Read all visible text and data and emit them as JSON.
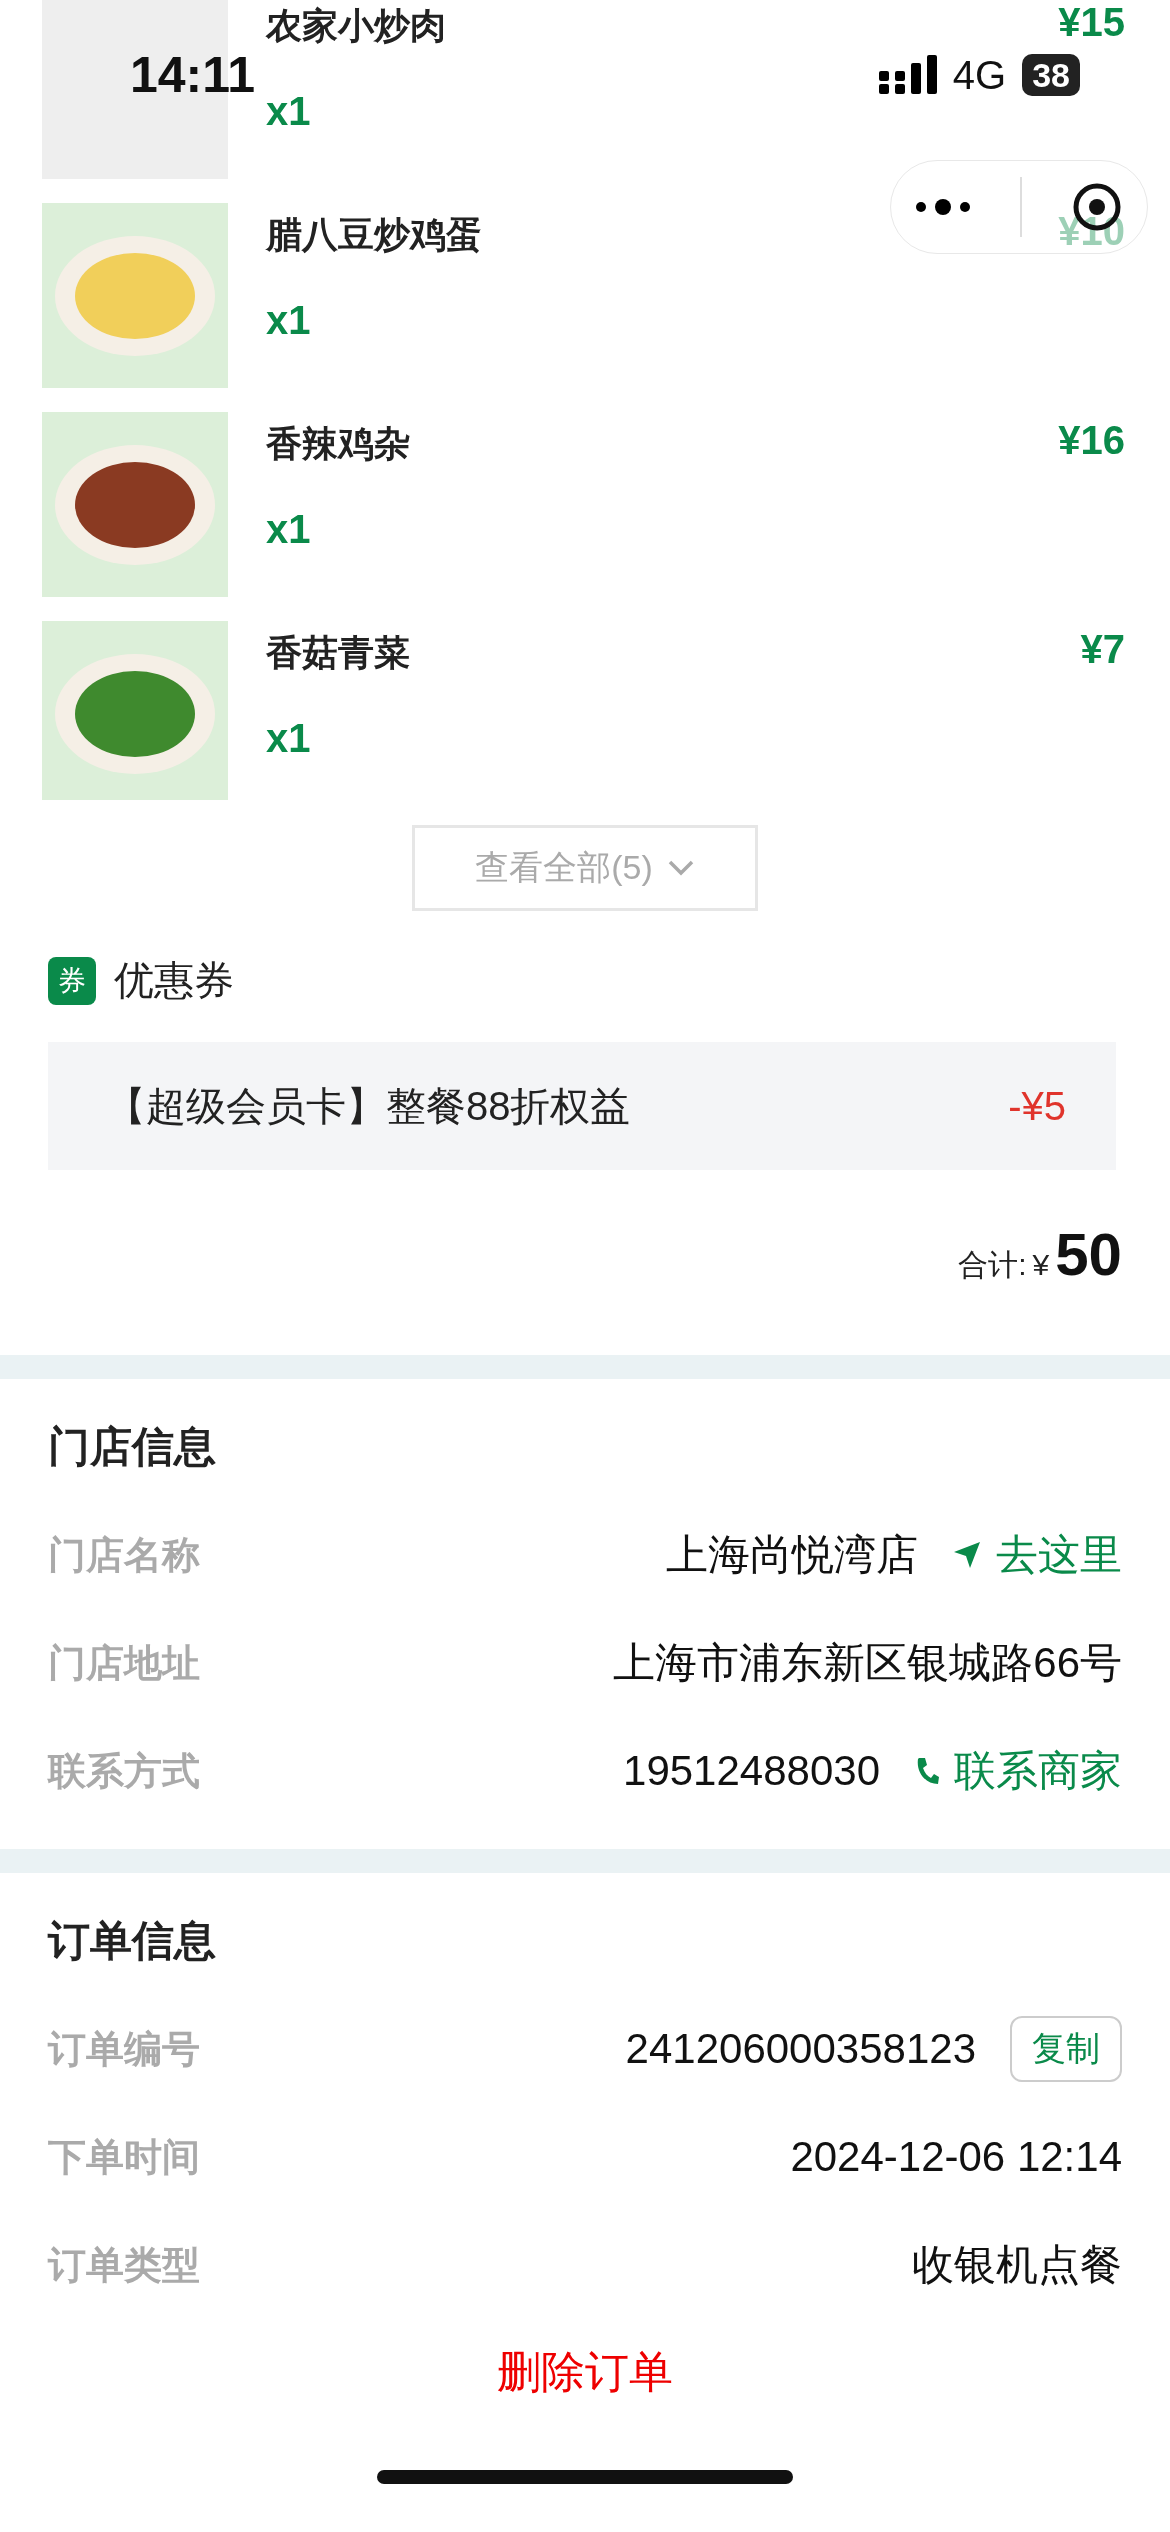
{
  "status_bar": {
    "time": "14:11",
    "network": "4G",
    "battery": "38"
  },
  "items": [
    {
      "name": "农家小炒肉",
      "quantity": "x1",
      "price": "¥15",
      "kind": "blank"
    },
    {
      "name": "腊八豆炒鸡蛋",
      "quantity": "x1",
      "price": "¥10",
      "kind": "eggs"
    },
    {
      "name": "香辣鸡杂",
      "quantity": "x1",
      "price": "¥16",
      "kind": "stew"
    },
    {
      "name": "香菇青菜",
      "quantity": "x1",
      "price": "¥7",
      "kind": "greens"
    }
  ],
  "view_all": "查看全部(5)",
  "coupon": {
    "badge": "券",
    "title": "优惠券",
    "name": "【超级会员卡】整餐88折权益",
    "amount": "-¥5"
  },
  "total": {
    "label": "合计:",
    "currency": "¥",
    "amount": "50"
  },
  "store": {
    "title": "门店信息",
    "rows": [
      {
        "label": "门店名称",
        "value": "上海尚悦湾店",
        "action": "去这里",
        "kind": "navigate"
      },
      {
        "label": "门店地址",
        "value": "上海市浦东新区银城路66号",
        "kind": "plain"
      },
      {
        "label": "联系方式",
        "value": "19512488030",
        "action": "联系商家",
        "kind": "call"
      }
    ]
  },
  "order": {
    "title": "订单信息",
    "rows": [
      {
        "label": "订单编号",
        "value": "241206000358123",
        "action": "复制",
        "kind": "copy"
      },
      {
        "label": "下单时间",
        "value": "2024-12-06 12:14",
        "kind": "plain"
      },
      {
        "label": "订单类型",
        "value": "收银机点餐",
        "kind": "plain"
      }
    ]
  },
  "delete": "删除订单"
}
